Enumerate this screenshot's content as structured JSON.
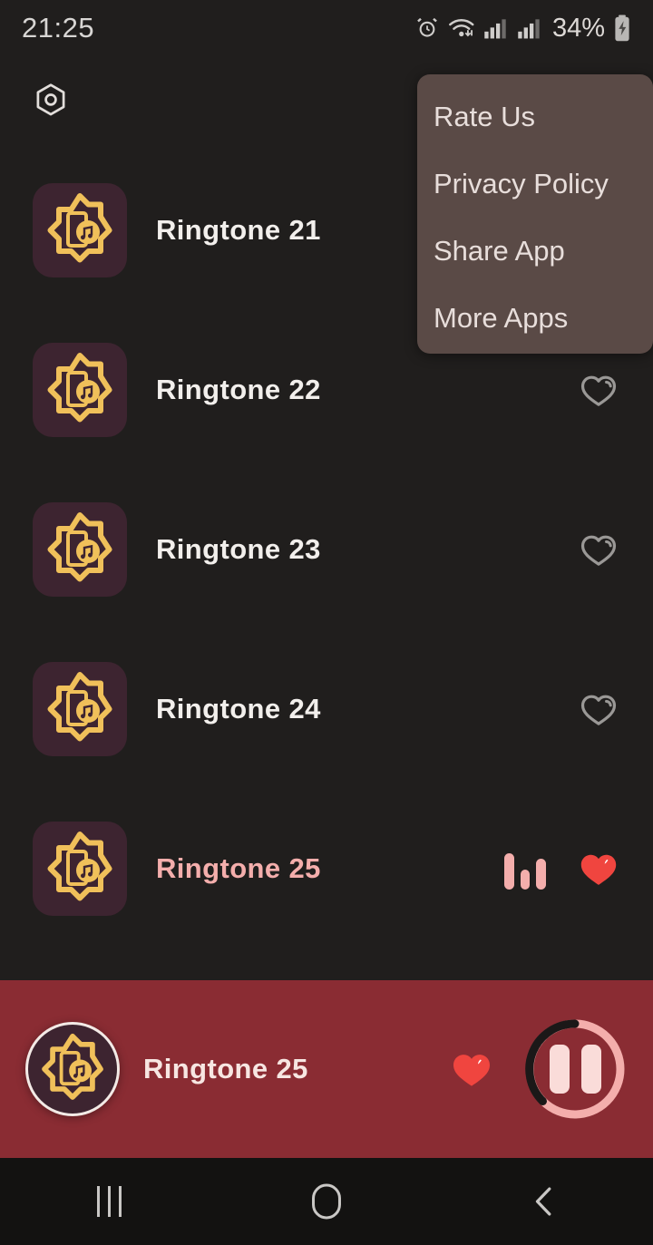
{
  "status_bar": {
    "time": "21:25",
    "battery_percent": "34%",
    "icons": [
      "alarm-icon",
      "wifi-icon",
      "signal-sim1-icon",
      "signal-sim2-icon",
      "battery-charging-icon"
    ]
  },
  "top_bar": {
    "settings_icon": "hexagon-settings-icon",
    "overflow_open": true
  },
  "overflow_menu": {
    "background": "#5a4a46",
    "items": [
      {
        "label": "Rate Us",
        "name": "menu-item-rate-us"
      },
      {
        "label": "Privacy Policy",
        "name": "menu-item-privacy-policy"
      },
      {
        "label": "Share App",
        "name": "menu-item-share-app"
      },
      {
        "label": "More Apps",
        "name": "menu-item-more-apps"
      }
    ]
  },
  "theme": {
    "background": "#201e1d",
    "accent_pink": "#f4aeac",
    "player_red": "#8a2c33",
    "heart_red": "#f0453f",
    "thumb_bg": "#3d2430",
    "gold": "#f0c05a"
  },
  "list": {
    "items": [
      {
        "title": "Ringtone 21",
        "favorite": false,
        "playing": false,
        "heart_visible": false,
        "thumb_icon": "ringtone-star-icon"
      },
      {
        "title": "Ringtone 22",
        "favorite": false,
        "playing": false,
        "heart_visible": true,
        "thumb_icon": "ringtone-star-icon"
      },
      {
        "title": "Ringtone 23",
        "favorite": false,
        "playing": false,
        "heart_visible": true,
        "thumb_icon": "ringtone-star-icon"
      },
      {
        "title": "Ringtone 24",
        "favorite": false,
        "playing": false,
        "heart_visible": true,
        "thumb_icon": "ringtone-star-icon"
      },
      {
        "title": "Ringtone 25",
        "favorite": true,
        "playing": true,
        "heart_visible": true,
        "thumb_icon": "ringtone-star-icon"
      }
    ]
  },
  "player": {
    "title": "Ringtone 25",
    "favorite": true,
    "state": "playing",
    "control_icon": "pause-icon",
    "progress_percent": 72,
    "thumb_icon": "ringtone-star-icon"
  },
  "nav_bar": {
    "recents_label": "recent-apps-icon",
    "home_label": "home-icon",
    "back_label": "back-icon"
  }
}
